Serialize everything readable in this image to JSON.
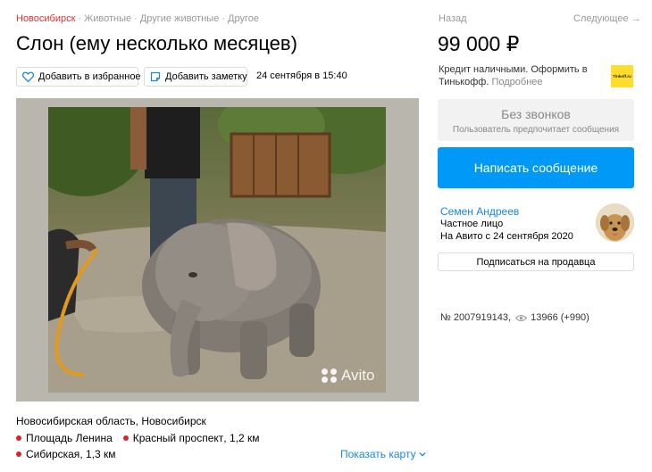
{
  "breadcrumbs": [
    "Новосибирск",
    "Животные",
    "Другие животные",
    "Другое"
  ],
  "breadcrumb_separator": "·",
  "listing": {
    "title": "Слон (ему несколько месяцев)",
    "add_favorite_label": "Добавить в избранное",
    "add_note_label": "Добавить заметку",
    "posted_at": "24 сентября в 15:40"
  },
  "photo": {
    "watermark": "Avito"
  },
  "location": {
    "address": "Новосибирская область, Новосибирск",
    "metro": [
      {
        "station": "Площадь Ленина",
        "distance": ""
      },
      {
        "station": "Красный проспект",
        "distance": "1,2 км"
      },
      {
        "station": "Сибирская",
        "distance": "1,3 км"
      }
    ],
    "show_map_label": "Показать карту"
  },
  "nav": {
    "back_label": "Назад",
    "next_label": "Следующее →"
  },
  "price": "99 000 ₽",
  "credit": {
    "text": "Кредит наличными. Оформить в Тинькофф.",
    "more_label": "Подробнее",
    "logo_text": "Tinkoff.ru"
  },
  "contact": {
    "no_calls_title": "Без звонков",
    "no_calls_sub": "Пользователь предпочитает сообщения",
    "write_label": "Написать сообщение"
  },
  "seller": {
    "name": "Семен Андреев",
    "type": "Частное лицо",
    "since": "На Авито с 24 сентября 2020",
    "subscribe_label": "Подписаться на продавца"
  },
  "stats": {
    "ad_number": "№ 2007919143,",
    "views": "13966 (+990)"
  },
  "colors": {
    "accent": "#0099f7",
    "link": "#1787e0",
    "breadcrumb_active": "#dd3333",
    "metro_red": "#d1262c",
    "tinkoff_yellow": "#ffdd2d"
  },
  "icons": [
    "heart-icon",
    "note-icon",
    "chevron-down-icon",
    "eye-icon",
    "avito-logo-icon"
  ]
}
